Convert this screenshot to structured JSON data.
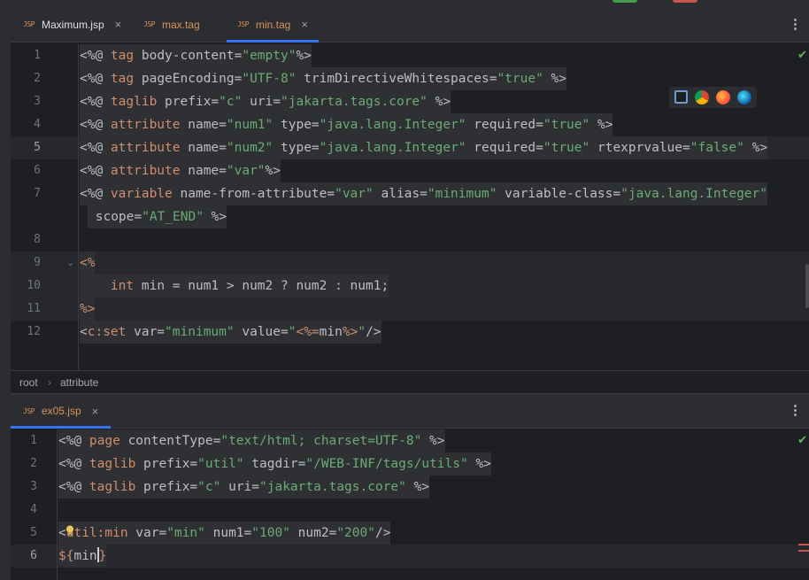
{
  "top_pane": {
    "tabs": [
      {
        "type_badge": "JSP",
        "name": "Maximum.jsp",
        "close": "×",
        "active": false
      },
      {
        "type_badge": "JSP",
        "name": "max.tag",
        "close": "",
        "active": false
      },
      {
        "type_badge": "JSP",
        "name": "min.tag",
        "close": "×",
        "active": true
      }
    ],
    "menu_icon": "⋮",
    "line_numbers": [
      "1",
      "2",
      "3",
      "4",
      "5",
      "6",
      "7",
      "",
      "8",
      "9",
      "10",
      "11",
      "12"
    ],
    "lines": [
      [
        {
          "t": "<%@ ",
          "c": "plain"
        },
        {
          "t": "tag",
          "c": "kw"
        },
        {
          "t": " body-content=",
          "c": "plain"
        },
        {
          "t": "\"empty\"",
          "c": "str"
        },
        {
          "t": "%>",
          "c": "plain"
        }
      ],
      [
        {
          "t": "<%@ ",
          "c": "plain"
        },
        {
          "t": "tag",
          "c": "kw"
        },
        {
          "t": " pageEncoding=",
          "c": "plain"
        },
        {
          "t": "\"UTF-8\"",
          "c": "str"
        },
        {
          "t": " trimDirectiveWhitespaces=",
          "c": "plain"
        },
        {
          "t": "\"true\"",
          "c": "str"
        },
        {
          "t": " %>",
          "c": "plain"
        }
      ],
      [
        {
          "t": "<%@ ",
          "c": "plain"
        },
        {
          "t": "taglib",
          "c": "kw"
        },
        {
          "t": " prefix=",
          "c": "plain"
        },
        {
          "t": "\"c\"",
          "c": "str"
        },
        {
          "t": " uri=",
          "c": "plain"
        },
        {
          "t": "\"jakarta.tags.core\"",
          "c": "str"
        },
        {
          "t": " %>",
          "c": "plain"
        }
      ],
      [
        {
          "t": "<%@ ",
          "c": "plain"
        },
        {
          "t": "attribute",
          "c": "kw"
        },
        {
          "t": " name=",
          "c": "plain"
        },
        {
          "t": "\"num1\"",
          "c": "str"
        },
        {
          "t": " type=",
          "c": "plain"
        },
        {
          "t": "\"java.lang.Integer\"",
          "c": "str"
        },
        {
          "t": " required=",
          "c": "plain"
        },
        {
          "t": "\"true\"",
          "c": "str"
        },
        {
          "t": " %>",
          "c": "plain"
        }
      ],
      [
        {
          "t": "<%@ ",
          "c": "plain"
        },
        {
          "t": "attribute",
          "c": "kw"
        },
        {
          "t": " name=",
          "c": "plain"
        },
        {
          "t": "\"num2\"",
          "c": "str"
        },
        {
          "t": " type=",
          "c": "plain"
        },
        {
          "t": "\"java.lang.Integer\"",
          "c": "str"
        },
        {
          "t": " required=",
          "c": "plain"
        },
        {
          "t": "\"true\"",
          "c": "str"
        },
        {
          "t": " rtexprvalue=",
          "c": "plain"
        },
        {
          "t": "\"false\"",
          "c": "str"
        },
        {
          "t": " %>",
          "c": "plain"
        }
      ],
      [
        {
          "t": "<%@ ",
          "c": "plain"
        },
        {
          "t": "attribute",
          "c": "kw"
        },
        {
          "t": " name=",
          "c": "plain"
        },
        {
          "t": "\"var\"",
          "c": "str"
        },
        {
          "t": "%>",
          "c": "plain"
        }
      ],
      [
        {
          "t": "<%@ ",
          "c": "plain"
        },
        {
          "t": "variable",
          "c": "kw"
        },
        {
          "t": " name-from-attribute=",
          "c": "plain"
        },
        {
          "t": "\"var\"",
          "c": "str"
        },
        {
          "t": " alias=",
          "c": "plain"
        },
        {
          "t": "\"minimum\"",
          "c": "str"
        },
        {
          "t": " variable-class=",
          "c": "plain"
        },
        {
          "t": "\"java.lang.Integer\"",
          "c": "str"
        }
      ],
      [
        {
          "t": " scope=",
          "c": "plain"
        },
        {
          "t": "\"AT_END\"",
          "c": "str"
        },
        {
          "t": " %>",
          "c": "plain"
        }
      ],
      [],
      [
        {
          "t": "<%",
          "c": "kw"
        }
      ],
      [
        {
          "t": "    ",
          "c": "plain"
        },
        {
          "t": "int",
          "c": "kw"
        },
        {
          "t": " min = num1 > num2 ? num2 : num1;",
          "c": "plain"
        }
      ],
      [
        {
          "t": "%>",
          "c": "kw"
        }
      ],
      [
        {
          "t": "<",
          "c": "plain"
        },
        {
          "t": "c:set",
          "c": "kw"
        },
        {
          "t": " var=",
          "c": "plain"
        },
        {
          "t": "\"minimum\"",
          "c": "str"
        },
        {
          "t": " value=",
          "c": "plain"
        },
        {
          "t": "\"",
          "c": "str"
        },
        {
          "t": "<%=",
          "c": "kw"
        },
        {
          "t": "min",
          "c": "plain"
        },
        {
          "t": "%>",
          "c": "kw"
        },
        {
          "t": "\"",
          "c": "str"
        },
        {
          "t": "/>",
          "c": "plain"
        }
      ]
    ]
  },
  "breadcrumb": {
    "items": [
      "root",
      "attribute"
    ],
    "separator": "›"
  },
  "bottom_pane": {
    "tabs": [
      {
        "type_badge": "JSP",
        "name": "ex05.jsp",
        "close": "×",
        "active": true
      }
    ],
    "menu_icon": "⋮",
    "line_numbers": [
      "1",
      "2",
      "3",
      "4",
      "5",
      "6"
    ],
    "lines": [
      [
        {
          "t": "<%@ ",
          "c": "plain"
        },
        {
          "t": "page",
          "c": "kw"
        },
        {
          "t": " contentType=",
          "c": "plain"
        },
        {
          "t": "\"text/html; charset=UTF-8\"",
          "c": "str"
        },
        {
          "t": " %>",
          "c": "plain"
        }
      ],
      [
        {
          "t": "<%@ ",
          "c": "plain"
        },
        {
          "t": "taglib",
          "c": "kw"
        },
        {
          "t": " prefix=",
          "c": "plain"
        },
        {
          "t": "\"util\"",
          "c": "str"
        },
        {
          "t": " tagdir=",
          "c": "plain"
        },
        {
          "t": "\"/WEB-INF/tags/utils\"",
          "c": "str"
        },
        {
          "t": " %>",
          "c": "plain"
        }
      ],
      [
        {
          "t": "<%@ ",
          "c": "plain"
        },
        {
          "t": "taglib",
          "c": "kw"
        },
        {
          "t": " prefix=",
          "c": "plain"
        },
        {
          "t": "\"c\"",
          "c": "str"
        },
        {
          "t": " uri=",
          "c": "plain"
        },
        {
          "t": "\"jakarta.tags.core\"",
          "c": "str"
        },
        {
          "t": " %>",
          "c": "plain"
        }
      ],
      [],
      [
        {
          "t": "<",
          "c": "plain"
        },
        {
          "t": "util:min",
          "c": "kw"
        },
        {
          "t": " var=",
          "c": "plain"
        },
        {
          "t": "\"min\"",
          "c": "str"
        },
        {
          "t": " num1=",
          "c": "plain"
        },
        {
          "t": "\"100\"",
          "c": "str"
        },
        {
          "t": " num2=",
          "c": "plain"
        },
        {
          "t": "\"200\"",
          "c": "str"
        },
        {
          "t": "/>",
          "c": "plain"
        }
      ],
      [
        {
          "t": "${",
          "c": "brace"
        },
        {
          "t": "min",
          "c": "plain"
        },
        {
          "t": "}",
          "c": "brace"
        }
      ]
    ]
  },
  "colors": {
    "keyword": "#cf8e6d",
    "string": "#6aab73",
    "text": "#bcbec4",
    "accent": "#3574f0",
    "background": "#1e1f22"
  },
  "icons": [
    "inspection-ok-icon",
    "intellij-icon",
    "chrome-icon",
    "firefox-icon",
    "edge-icon",
    "fold-arrow-icon",
    "lightbulb-icon"
  ]
}
